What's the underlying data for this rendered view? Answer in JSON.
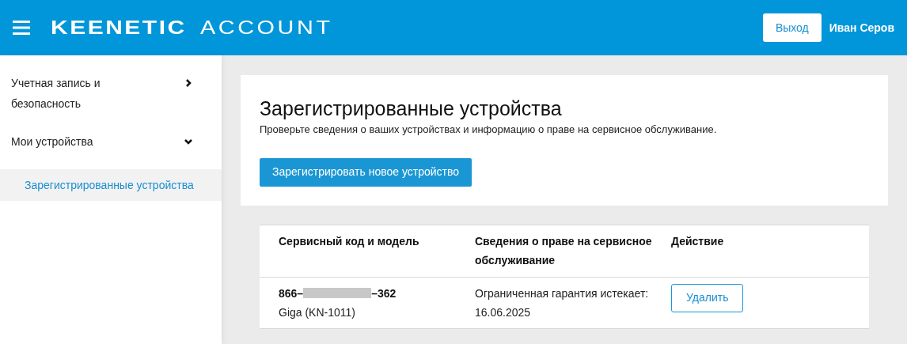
{
  "header": {
    "logo_brand": "KEENETIC",
    "logo_product": "ACCOUNT",
    "logout_button": "Выход",
    "user_name": "Иван Серов"
  },
  "sidebar": {
    "items": [
      {
        "label": "Учетная запись и безопасность",
        "expanded": false
      },
      {
        "label": "Мои устройства",
        "expanded": true,
        "children": [
          {
            "label": "Зарегистрированные устройства",
            "selected": true
          }
        ]
      }
    ]
  },
  "page": {
    "title": "Зарегистрированные устройства",
    "subtitle": "Проверьте сведения о ваших устройствах и информацию о праве на сервисное обслуживание.",
    "register_button": "Зарегистрировать новое устройство"
  },
  "table": {
    "columns": [
      "Сервисный код и модель",
      "Сведения о праве на сервисное обслуживание",
      "Действие"
    ],
    "rows": [
      {
        "code_prefix": "866–",
        "code_suffix": "–362",
        "model": "Giga (KN-1011)",
        "warranty": "Ограниченная гарантия истекает: 16.06.2025",
        "action": "Удалить"
      }
    ]
  }
}
